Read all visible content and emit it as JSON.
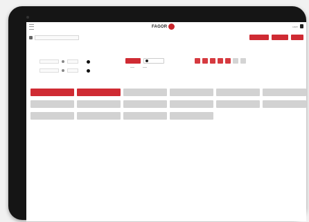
{
  "header": {
    "logo_text": "FAGOR",
    "user_text": "user"
  },
  "filter_bar": {
    "select_value": "",
    "info_text": "",
    "buttons": [
      {
        "label": ""
      },
      {
        "label": ""
      },
      {
        "label": ""
      }
    ]
  },
  "left_panel": {
    "title": "",
    "rows": [
      {
        "label": "",
        "field": ""
      },
      {
        "label": "",
        "field": ""
      }
    ]
  },
  "mode_panel": {
    "title": "",
    "active_option": "",
    "inactive_option": ""
  },
  "squares_panel": {
    "title": "",
    "red_count": 5,
    "gray_count": 2
  },
  "tiles": {
    "title": "",
    "items": [
      {
        "label": "",
        "active": true
      },
      {
        "label": "",
        "active": true
      },
      {
        "label": "",
        "active": false
      },
      {
        "label": "",
        "active": false
      },
      {
        "label": "",
        "active": false
      },
      {
        "label": "",
        "active": false
      },
      {
        "label": "",
        "active": false
      },
      {
        "label": "",
        "active": false
      },
      {
        "label": "",
        "active": false
      },
      {
        "label": "",
        "active": false
      },
      {
        "label": "",
        "active": false
      },
      {
        "label": "",
        "active": false
      },
      {
        "label": "",
        "active": false
      },
      {
        "label": "",
        "active": false
      },
      {
        "label": "",
        "active": false
      },
      {
        "label": "",
        "active": false
      }
    ]
  },
  "colors": {
    "accent": "#cf2b33",
    "tile_inactive": "#d2d2d2",
    "device_frame": "#151515"
  }
}
